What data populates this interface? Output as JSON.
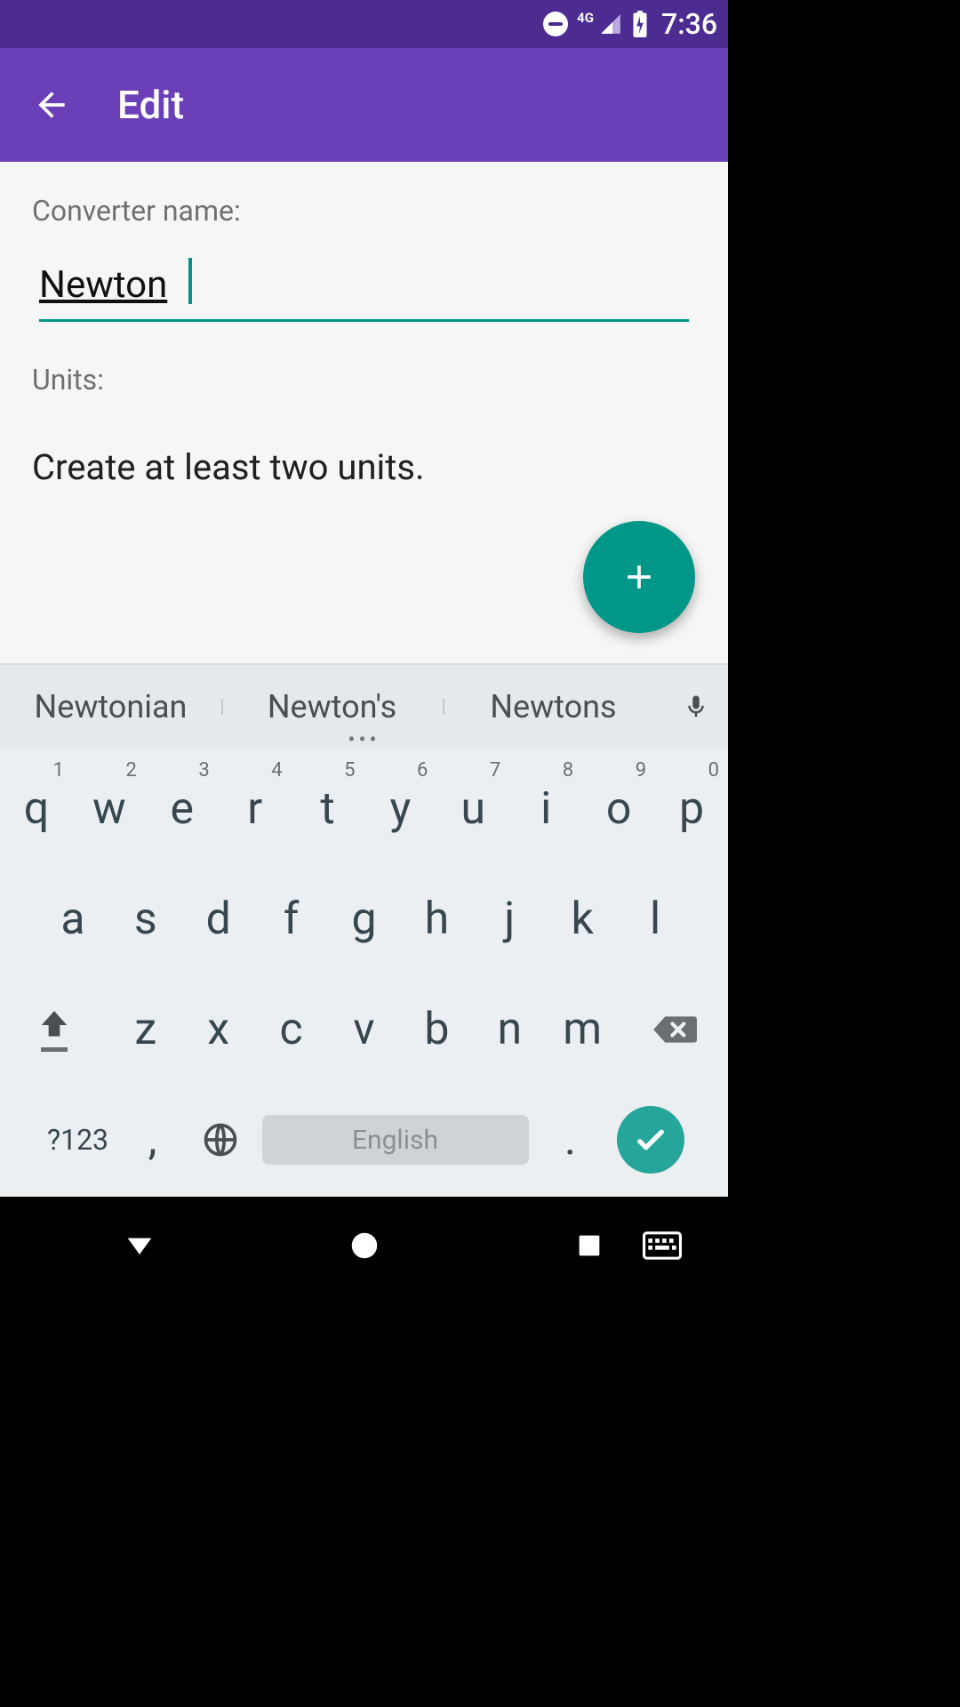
{
  "status": {
    "network_label": "4G",
    "time": "7:36"
  },
  "appbar": {
    "title": "Edit"
  },
  "form": {
    "name_label": "Converter name:",
    "name_value": "Newton",
    "units_label": "Units:",
    "units_instruction": "Create at least two units."
  },
  "keyboard": {
    "suggestions": [
      "Newtonian",
      "Newton's",
      "Newtons"
    ],
    "space_label": "English",
    "symbols_label": "?123",
    "row1_nums": [
      "1",
      "2",
      "3",
      "4",
      "5",
      "6",
      "7",
      "8",
      "9",
      "0"
    ],
    "row1": [
      "q",
      "w",
      "e",
      "r",
      "t",
      "y",
      "u",
      "i",
      "o",
      "p"
    ],
    "row2": [
      "a",
      "s",
      "d",
      "f",
      "g",
      "h",
      "j",
      "k",
      "l"
    ],
    "row3": [
      "z",
      "x",
      "c",
      "v",
      "b",
      "n",
      "m"
    ],
    "comma": ",",
    "period": "."
  }
}
